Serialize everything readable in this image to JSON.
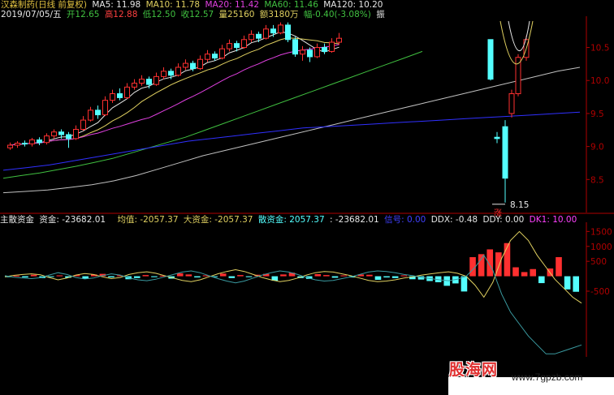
{
  "header": {
    "title": "汉森制药(日线 前复权)",
    "ma5": "MA5: 11.98",
    "ma10": "MA10: 11.78",
    "ma20": "MA20: 11.42",
    "ma60": "MA60: 11.46",
    "ma120": "MA120: 10.20",
    "date": "2019/07/05/五",
    "open": "开12.65",
    "high": "高12.88",
    "low": "低12.50",
    "close": "收12.57",
    "volume": "量25160",
    "amount": "额3180万",
    "change": "幅-0.40(-3.08%)",
    "amp": "振"
  },
  "indicator": {
    "name": "主散资金",
    "zj": "资金: -23682.01",
    "avg": "均值: -2057.37",
    "big": "大资金: -2057.37",
    "small": "散资金: 2057.37",
    "colon": ": -23682.01",
    "xh": "信号: 0.00",
    "ddx": "DDX: -0.48",
    "ddy": "DDY: 0.00",
    "dk1": "DK1: 10.00"
  },
  "colors": {
    "up": "#ff3030",
    "down": "#54ffff",
    "ma5": "#e6e6e6",
    "ma10": "#e0d060",
    "ma20": "#e040e0",
    "ma60": "#40c040",
    "ma120": "#c0c0c0",
    "blue": "#3030ff",
    "axis": "#b00000"
  },
  "annotations": {
    "low_price": "8.15",
    "marker": "涨"
  },
  "watermark": {
    "site_cn": "股海网",
    "site_url": "www.7gpzb.com"
  },
  "chart_data": [
    {
      "type": "candlestick",
      "title": "汉森制药(日线 前复权)",
      "ylim": [
        8.0,
        10.9
      ],
      "yticks": [
        {
          "v": 8.5,
          "label": "8.5"
        },
        {
          "v": 9.0,
          "label": "9.0"
        },
        {
          "v": 9.5,
          "label": "9.5"
        },
        {
          "v": 10.0,
          "label": "10.0"
        },
        {
          "v": 10.5,
          "label": "10.5"
        }
      ],
      "candles": [
        {
          "o": 8.98,
          "c": 9.02,
          "h": 9.06,
          "l": 8.95
        },
        {
          "o": 9.02,
          "c": 9.05,
          "h": 9.08,
          "l": 8.98
        },
        {
          "o": 9.05,
          "c": 9.04,
          "h": 9.09,
          "l": 9.0
        },
        {
          "o": 9.04,
          "c": 9.1,
          "h": 9.13,
          "l": 9.0
        },
        {
          "o": 9.1,
          "c": 9.06,
          "h": 9.14,
          "l": 9.02
        },
        {
          "o": 9.06,
          "c": 9.16,
          "h": 9.2,
          "l": 9.03
        },
        {
          "o": 9.16,
          "c": 9.22,
          "h": 9.26,
          "l": 9.12
        },
        {
          "o": 9.22,
          "c": 9.18,
          "h": 9.26,
          "l": 9.12
        },
        {
          "o": 9.18,
          "c": 9.12,
          "h": 9.22,
          "l": 8.98
        },
        {
          "o": 9.12,
          "c": 9.26,
          "h": 9.32,
          "l": 9.1
        },
        {
          "o": 9.26,
          "c": 9.4,
          "h": 9.46,
          "l": 9.24
        },
        {
          "o": 9.4,
          "c": 9.55,
          "h": 9.6,
          "l": 9.38
        },
        {
          "o": 9.55,
          "c": 9.48,
          "h": 9.62,
          "l": 9.42
        },
        {
          "o": 9.48,
          "c": 9.7,
          "h": 9.76,
          "l": 9.46
        },
        {
          "o": 9.7,
          "c": 9.8,
          "h": 9.86,
          "l": 9.66
        },
        {
          "o": 9.8,
          "c": 9.74,
          "h": 9.88,
          "l": 9.7
        },
        {
          "o": 9.74,
          "c": 9.9,
          "h": 9.96,
          "l": 9.72
        },
        {
          "o": 9.9,
          "c": 9.96,
          "h": 10.02,
          "l": 9.86
        },
        {
          "o": 9.96,
          "c": 10.02,
          "h": 10.08,
          "l": 9.92
        },
        {
          "o": 10.02,
          "c": 9.94,
          "h": 10.06,
          "l": 9.88
        },
        {
          "o": 9.94,
          "c": 10.06,
          "h": 10.12,
          "l": 9.92
        },
        {
          "o": 10.06,
          "c": 10.14,
          "h": 10.2,
          "l": 10.02
        },
        {
          "o": 10.14,
          "c": 10.08,
          "h": 10.18,
          "l": 10.02
        },
        {
          "o": 10.08,
          "c": 10.2,
          "h": 10.26,
          "l": 10.06
        },
        {
          "o": 10.2,
          "c": 10.26,
          "h": 10.32,
          "l": 10.16
        },
        {
          "o": 10.26,
          "c": 10.18,
          "h": 10.3,
          "l": 10.14
        },
        {
          "o": 10.18,
          "c": 10.32,
          "h": 10.38,
          "l": 10.16
        },
        {
          "o": 10.32,
          "c": 10.4,
          "h": 10.46,
          "l": 10.28
        },
        {
          "o": 10.4,
          "c": 10.34,
          "h": 10.44,
          "l": 10.3
        },
        {
          "o": 10.34,
          "c": 10.48,
          "h": 10.54,
          "l": 10.32
        },
        {
          "o": 10.48,
          "c": 10.56,
          "h": 10.62,
          "l": 10.44
        },
        {
          "o": 10.56,
          "c": 10.5,
          "h": 10.6,
          "l": 10.44
        },
        {
          "o": 10.5,
          "c": 10.62,
          "h": 10.68,
          "l": 10.48
        },
        {
          "o": 10.62,
          "c": 10.7,
          "h": 10.76,
          "l": 10.58
        },
        {
          "o": 10.7,
          "c": 10.64,
          "h": 10.74,
          "l": 10.58
        },
        {
          "o": 10.64,
          "c": 10.78,
          "h": 10.84,
          "l": 10.62
        },
        {
          "o": 10.78,
          "c": 10.72,
          "h": 10.84,
          "l": 10.66
        },
        {
          "o": 10.72,
          "c": 10.84,
          "h": 10.88,
          "l": 10.7
        },
        {
          "o": 10.84,
          "c": 10.62,
          "h": 10.88,
          "l": 10.58
        },
        {
          "o": 10.62,
          "c": 10.4,
          "h": 10.66,
          "l": 10.36
        },
        {
          "o": 10.4,
          "c": 10.46,
          "h": 10.52,
          "l": 10.3
        },
        {
          "o": 10.46,
          "c": 10.36,
          "h": 10.5,
          "l": 10.28
        },
        {
          "o": 10.36,
          "c": 10.5,
          "h": 10.56,
          "l": 10.34
        },
        {
          "o": 10.5,
          "c": 10.44,
          "h": 10.56,
          "l": 10.4
        },
        {
          "o": 10.44,
          "c": 10.58,
          "h": 10.64,
          "l": 10.42
        },
        {
          "o": 10.58,
          "c": 10.64,
          "h": 10.72,
          "l": 10.54
        }
      ],
      "candles_right": [
        {
          "o": 10.62,
          "c": 10.02,
          "h": 10.62,
          "l": 10.0
        },
        {
          "o": 9.14,
          "c": 9.12,
          "h": 9.22,
          "l": 9.05
        },
        {
          "o": 9.3,
          "c": 8.52,
          "h": 9.4,
          "l": 8.15
        },
        {
          "o": 9.5,
          "c": 9.8,
          "h": 9.86,
          "l": 9.44
        },
        {
          "o": 9.8,
          "c": 10.35,
          "h": 10.4,
          "l": 9.76
        },
        {
          "o": 10.35,
          "c": 10.62,
          "h": 10.68,
          "l": 10.3
        }
      ],
      "ma_lines": {
        "ma60": [
          8.52,
          8.56,
          8.6,
          8.65,
          8.7,
          8.76,
          8.82,
          8.9,
          8.98,
          9.06,
          9.14,
          9.24,
          9.34,
          9.44,
          9.54,
          9.64,
          9.74,
          9.84,
          9.94,
          10.04,
          10.14,
          10.24,
          10.34,
          10.44
        ],
        "ma120": [
          8.3,
          8.32,
          8.34,
          8.38,
          8.42,
          8.48,
          8.56,
          8.66,
          8.76,
          8.86,
          8.94,
          9.02,
          9.1,
          9.18,
          9.26,
          9.34,
          9.42,
          9.5,
          9.58,
          9.66,
          9.74,
          9.82,
          9.9,
          9.98,
          10.06,
          10.14,
          10.2
        ],
        "blue": [
          8.64,
          8.68,
          8.72,
          8.78,
          8.84,
          8.9,
          8.96,
          9.02,
          9.08,
          9.12,
          9.16,
          9.2,
          9.24,
          9.28,
          9.3,
          9.32,
          9.34,
          9.36,
          9.38,
          9.4,
          9.42,
          9.44,
          9.46,
          9.48,
          9.5,
          9.52
        ]
      }
    },
    {
      "type": "bar",
      "title": "主散资金",
      "ylim": [
        -2700,
        1700
      ],
      "yticks": [
        {
          "v": 1500,
          "label": "1500"
        },
        {
          "v": 1000,
          "label": "1000"
        },
        {
          "v": 500,
          "label": "500"
        },
        {
          "v": -500,
          "label": "-500"
        }
      ],
      "values": [
        -30,
        20,
        -40,
        50,
        -60,
        -20,
        30,
        -50,
        40,
        -80,
        60,
        80,
        -40,
        30,
        -100,
        -60,
        40,
        -30,
        20,
        -80,
        100,
        60,
        -40,
        30,
        -20,
        90,
        -60,
        40,
        -30,
        50,
        80,
        -150,
        60,
        120,
        -60,
        -90,
        70,
        40,
        -50,
        30,
        -40,
        60,
        50,
        -120,
        -40,
        -60,
        30,
        -100,
        -110,
        -160,
        -200,
        -320,
        -240,
        -510,
        640,
        740,
        900,
        800,
        1110,
        300,
        140,
        240,
        -230,
        260,
        640,
        -440,
        -520
      ],
      "lines": {
        "yellow": [
          -20,
          30,
          60,
          80,
          50,
          -40,
          -120,
          -60,
          40,
          90,
          60,
          -20,
          -80,
          -40,
          60,
          120,
          150,
          100,
          20,
          -60,
          -140,
          -180,
          -120,
          -20,
          80,
          160,
          220,
          160,
          60,
          -40,
          -120,
          -180,
          -140,
          -60,
          40,
          120,
          160,
          140,
          80,
          20,
          -60,
          -140,
          -180,
          -160,
          -120,
          -60,
          -20,
          40,
          80,
          120,
          150,
          100,
          0,
          -300,
          -700,
          -200,
          600,
          1200,
          1500,
          1200,
          700,
          300,
          -100,
          -400,
          -700,
          -900
        ],
        "cyan": [
          20,
          -30,
          -60,
          -80,
          -50,
          40,
          120,
          60,
          -40,
          -90,
          -60,
          20,
          80,
          40,
          -60,
          -120,
          -150,
          -100,
          -20,
          60,
          140,
          180,
          120,
          20,
          -80,
          -160,
          -220,
          -160,
          -60,
          40,
          120,
          180,
          140,
          60,
          -40,
          -120,
          -160,
          -140,
          -80,
          -20,
          60,
          140,
          180,
          160,
          120,
          60,
          20,
          -40,
          -80,
          -120,
          -150,
          -100,
          0,
          300,
          700,
          200,
          -600,
          -1200,
          -1600,
          -2000,
          -2300,
          -2600,
          -2600,
          -2500,
          -2400,
          -2300
        ]
      }
    }
  ]
}
